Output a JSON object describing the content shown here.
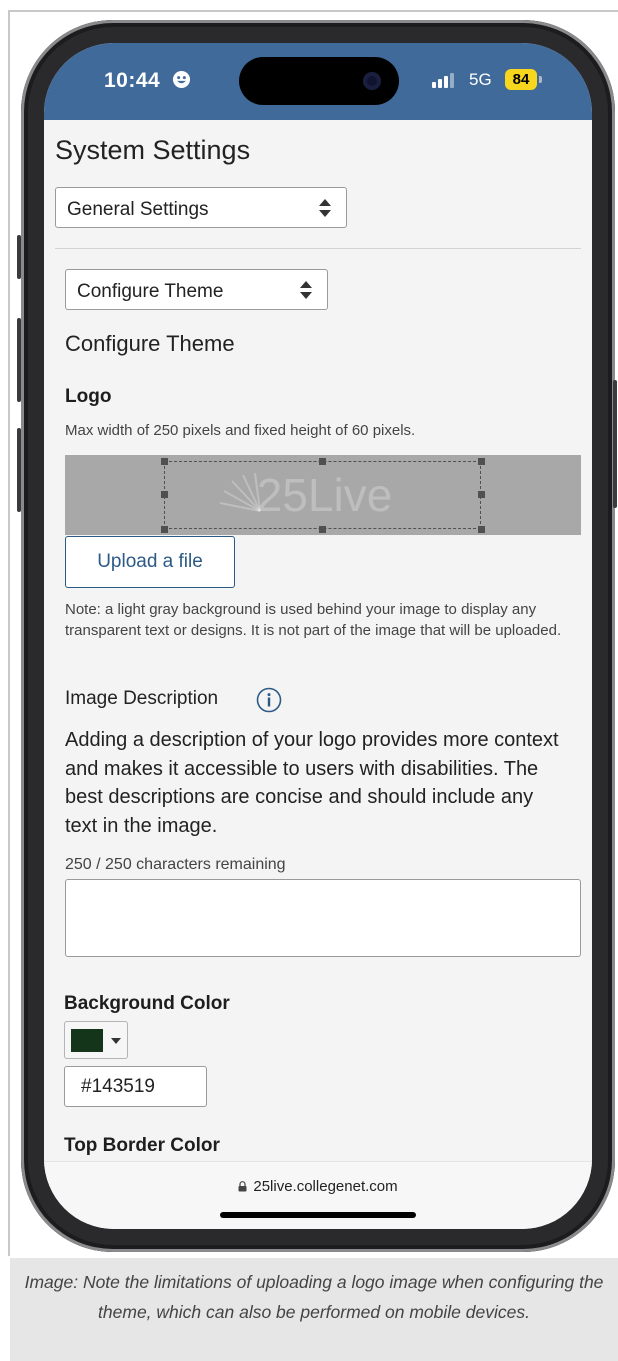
{
  "status_bar": {
    "time": "10:44",
    "network": "5G",
    "battery": "84"
  },
  "page": {
    "title": "System Settings",
    "settings_select": "General Settings",
    "theme_select": "Configure Theme",
    "section_title": "Configure Theme"
  },
  "logo": {
    "heading": "Logo",
    "hint": "Max width of 250 pixels and fixed height of 60 pixels.",
    "preview_text": "25Live",
    "upload_label": "Upload a file",
    "note": "Note: a light gray background is used behind your image to display any transparent text or designs. It is not part of the image that will be uploaded."
  },
  "image_description": {
    "label": "Image Description",
    "text": "Adding a description of your logo provides more context and makes it accessible to users with disabilities. The best descriptions are concise and should include any text in the image.",
    "chars_remaining": "250 / 250 characters remaining",
    "value": ""
  },
  "background_color": {
    "heading": "Background Color",
    "hex": "#143519",
    "swatch_color": "#143519"
  },
  "top_border_color": {
    "heading": "Top Border Color"
  },
  "browser": {
    "url": "25live.collegenet.com"
  },
  "caption": "Image: Note the limitations of uploading a logo image when configuring the theme, which can also be performed on mobile devices.",
  "colors": {
    "status_bar": "#3f6a9a",
    "accent": "#2c5a86",
    "battery": "#f7d71d"
  }
}
